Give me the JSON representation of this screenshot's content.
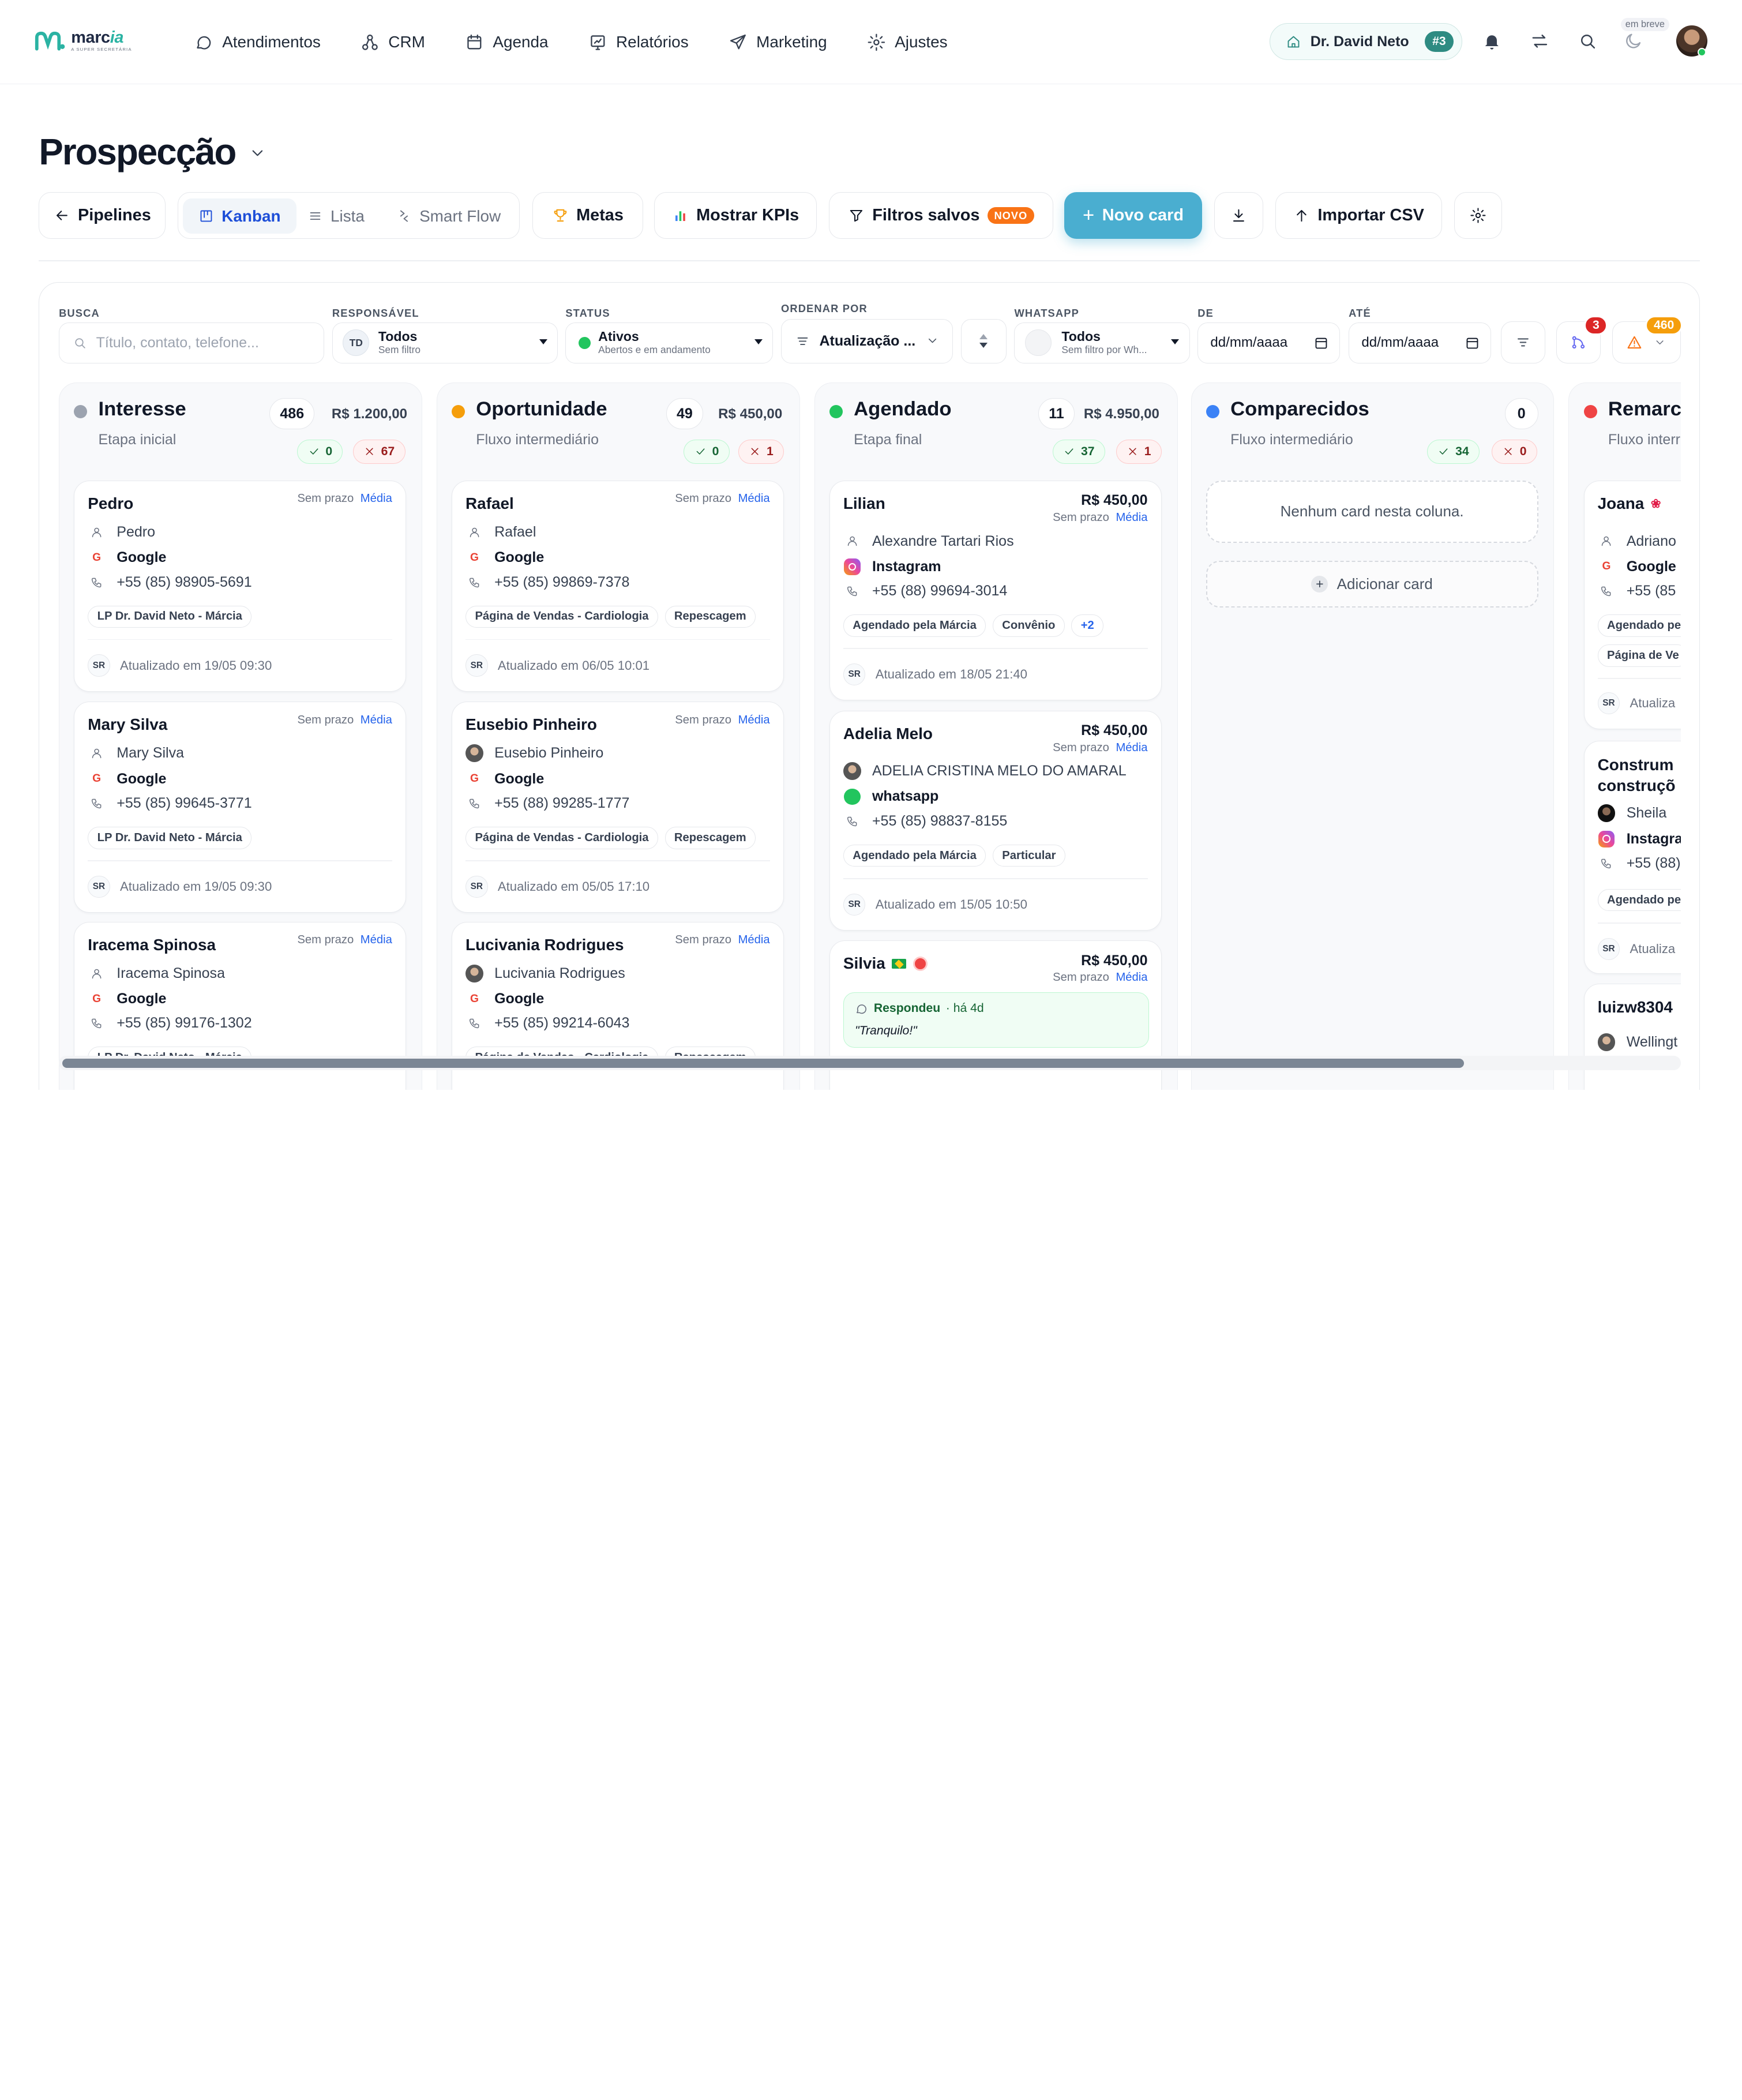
{
  "brand": {
    "name": "marc",
    "name_accent": "ia",
    "tagline": "A SUPER SECRETÁRIA"
  },
  "nav": [
    {
      "label": "Atendimentos",
      "icon": "chat-icon"
    },
    {
      "label": "CRM",
      "icon": "crm-nodes-icon"
    },
    {
      "label": "Agenda",
      "icon": "calendar-icon"
    },
    {
      "label": "Relatórios",
      "icon": "report-icon"
    },
    {
      "label": "Marketing",
      "icon": "send-icon"
    },
    {
      "label": "Ajustes",
      "icon": "gear-icon"
    }
  ],
  "topbar": {
    "doctor": "Dr. David Neto",
    "doctor_badge": "#3",
    "soon_label": "em breve"
  },
  "page": {
    "title": "Prospecção"
  },
  "toolbar": {
    "pipelines": "Pipelines",
    "kanban": "Kanban",
    "lista": "Lista",
    "smart_flow": "Smart Flow",
    "metas": "Metas",
    "kpis": "Mostrar KPIs",
    "filtros": "Filtros salvos",
    "novo_tag": "NOVO",
    "novo_card": "Novo card",
    "importar": "Importar CSV"
  },
  "filters": {
    "busca_label": "BUSCA",
    "busca_placeholder": "Título, contato, telefone...",
    "resp_label": "RESPONSÁVEL",
    "resp_initials": "TD",
    "resp_value": "Todos",
    "resp_sub": "Sem filtro",
    "status_label": "STATUS",
    "status_value": "Ativos",
    "status_sub": "Abertos e em andamento",
    "ordenar_label": "ORDENAR POR",
    "ordenar_value": "Atualização ...",
    "whatsapp_label": "WHATSAPP",
    "whatsapp_value": "Todos",
    "whatsapp_sub": "Sem filtro por Wh...",
    "de_label": "DE",
    "ate_label": "ATÉ",
    "date_ph": "dd/mm/aaaa",
    "badge_flow": "3",
    "badge_alert": "460"
  },
  "columns": [
    {
      "title": "Interesse",
      "subtitle": "Etapa inicial",
      "count": "486",
      "value": "R$ 1.200,00",
      "ok": "0",
      "bad": "67",
      "color": "#9ca3af"
    },
    {
      "title": "Oportunidade",
      "subtitle": "Fluxo intermediário",
      "count": "49",
      "value": "R$ 450,00",
      "ok": "0",
      "bad": "1",
      "color": "#f59e0b"
    },
    {
      "title": "Agendado",
      "subtitle": "Etapa final",
      "count": "11",
      "value": "R$ 4.950,00",
      "ok": "37",
      "bad": "1",
      "color": "#22c55e"
    },
    {
      "title": "Comparecidos",
      "subtitle": "Fluxo intermediário",
      "count": "0",
      "value": "",
      "ok": "34",
      "bad": "0",
      "color": "#3b82f6",
      "empty": "Nenhum card nesta coluna.",
      "add": "Adicionar card"
    },
    {
      "title": "Remarc",
      "subtitle": "Fluxo interr",
      "color": "#ef4444"
    }
  ],
  "cards": {
    "c1": [
      {
        "name": "Pedro",
        "meta": "Sem prazo",
        "prio": "Média",
        "contact": "Pedro",
        "source": "Google",
        "phone": "+55 (85) 98905-5691",
        "tags": [
          "LP Dr. David Neto - Márcia"
        ],
        "updated": "Atualizado em 19/05 09:30",
        "initials": "SR"
      },
      {
        "name": "Mary Silva",
        "meta": "Sem prazo",
        "prio": "Média",
        "contact": "Mary Silva",
        "source": "Google",
        "phone": "+55 (85) 99645-3771",
        "tags": [
          "LP Dr. David Neto - Márcia"
        ],
        "updated": "Atualizado em 19/05 09:30",
        "initials": "SR"
      },
      {
        "name": "Iracema Spinosa",
        "meta": "Sem prazo",
        "prio": "Média",
        "contact": "Iracema Spinosa",
        "source": "Google",
        "phone": "+55 (85) 99176-1302",
        "tags": [
          "LP Dr. David Neto - Márcia"
        ]
      }
    ],
    "c2": [
      {
        "name": "Rafael",
        "meta": "Sem prazo",
        "prio": "Média",
        "contact": "Rafael",
        "source": "Google",
        "phone": "+55 (85) 99869-7378",
        "tags": [
          "Página de Vendas - Cardiologia",
          "Repescagem"
        ],
        "updated": "Atualizado em 06/05 10:01",
        "initials": "SR"
      },
      {
        "name": "Eusebio Pinheiro",
        "meta": "Sem prazo",
        "prio": "Média",
        "contact": "Eusebio Pinheiro",
        "source": "Google",
        "phone": "+55 (88) 99285-1777",
        "tags": [
          "Página de Vendas - Cardiologia",
          "Repescagem"
        ],
        "updated": "Atualizado em 05/05 17:10",
        "initials": "SR"
      },
      {
        "name": "Lucivania Rodrigues",
        "meta": "Sem prazo",
        "prio": "Média",
        "contact": "Lucivania Rodrigues",
        "source": "Google",
        "phone": "+55 (85) 99214-6043",
        "tags": [
          "Página de Vendas - Cardiologia",
          "Repescagem"
        ]
      }
    ],
    "c3": [
      {
        "name": "Lilian",
        "price": "R$ 450,00",
        "meta": "Sem prazo",
        "prio": "Média",
        "contact": "Alexandre Tartari Rios",
        "source": "Instagram",
        "phone": "+55 (88) 99694-3014",
        "tags": [
          "Agendado pela Márcia",
          "Convênio",
          "+2"
        ],
        "updated": "Atualizado em 18/05 21:40",
        "initials": "SR"
      },
      {
        "name": "Adelia Melo",
        "price": "R$ 450,00",
        "meta": "Sem prazo",
        "prio": "Média",
        "contact": "ADELIA CRISTINA MELO DO AMARAL",
        "source": "whatsapp",
        "phone": "+55 (85) 98837-8155",
        "tags": [
          "Agendado pela Márcia",
          "Particular"
        ],
        "updated": "Atualizado em 15/05 10:50",
        "initials": "SR"
      },
      {
        "name": "Silvia",
        "price": "R$ 450,00",
        "meta": "Sem prazo",
        "prio": "Média",
        "reply_label": "Respondeu",
        "reply_time": "· há 4d",
        "reply_text": "\"Tranquilo!\""
      }
    ],
    "c5": [
      {
        "name": "Joana",
        "contact": "Adriano",
        "source": "Google",
        "phone": "+55 (85",
        "tags": [
          "Agendado pe",
          "Página de Ve"
        ],
        "updated": "Atualiza",
        "initials": "SR"
      },
      {
        "name": "Construm",
        "name2": "construçõ",
        "contact": "Sheila",
        "source": "Instagra",
        "phone": "+55 (88)",
        "tags": [
          "Agendado pe"
        ],
        "updated": "Atualiza",
        "initials": "SR"
      },
      {
        "name": "luizw8304",
        "contact": "Wellingt"
      }
    ]
  }
}
